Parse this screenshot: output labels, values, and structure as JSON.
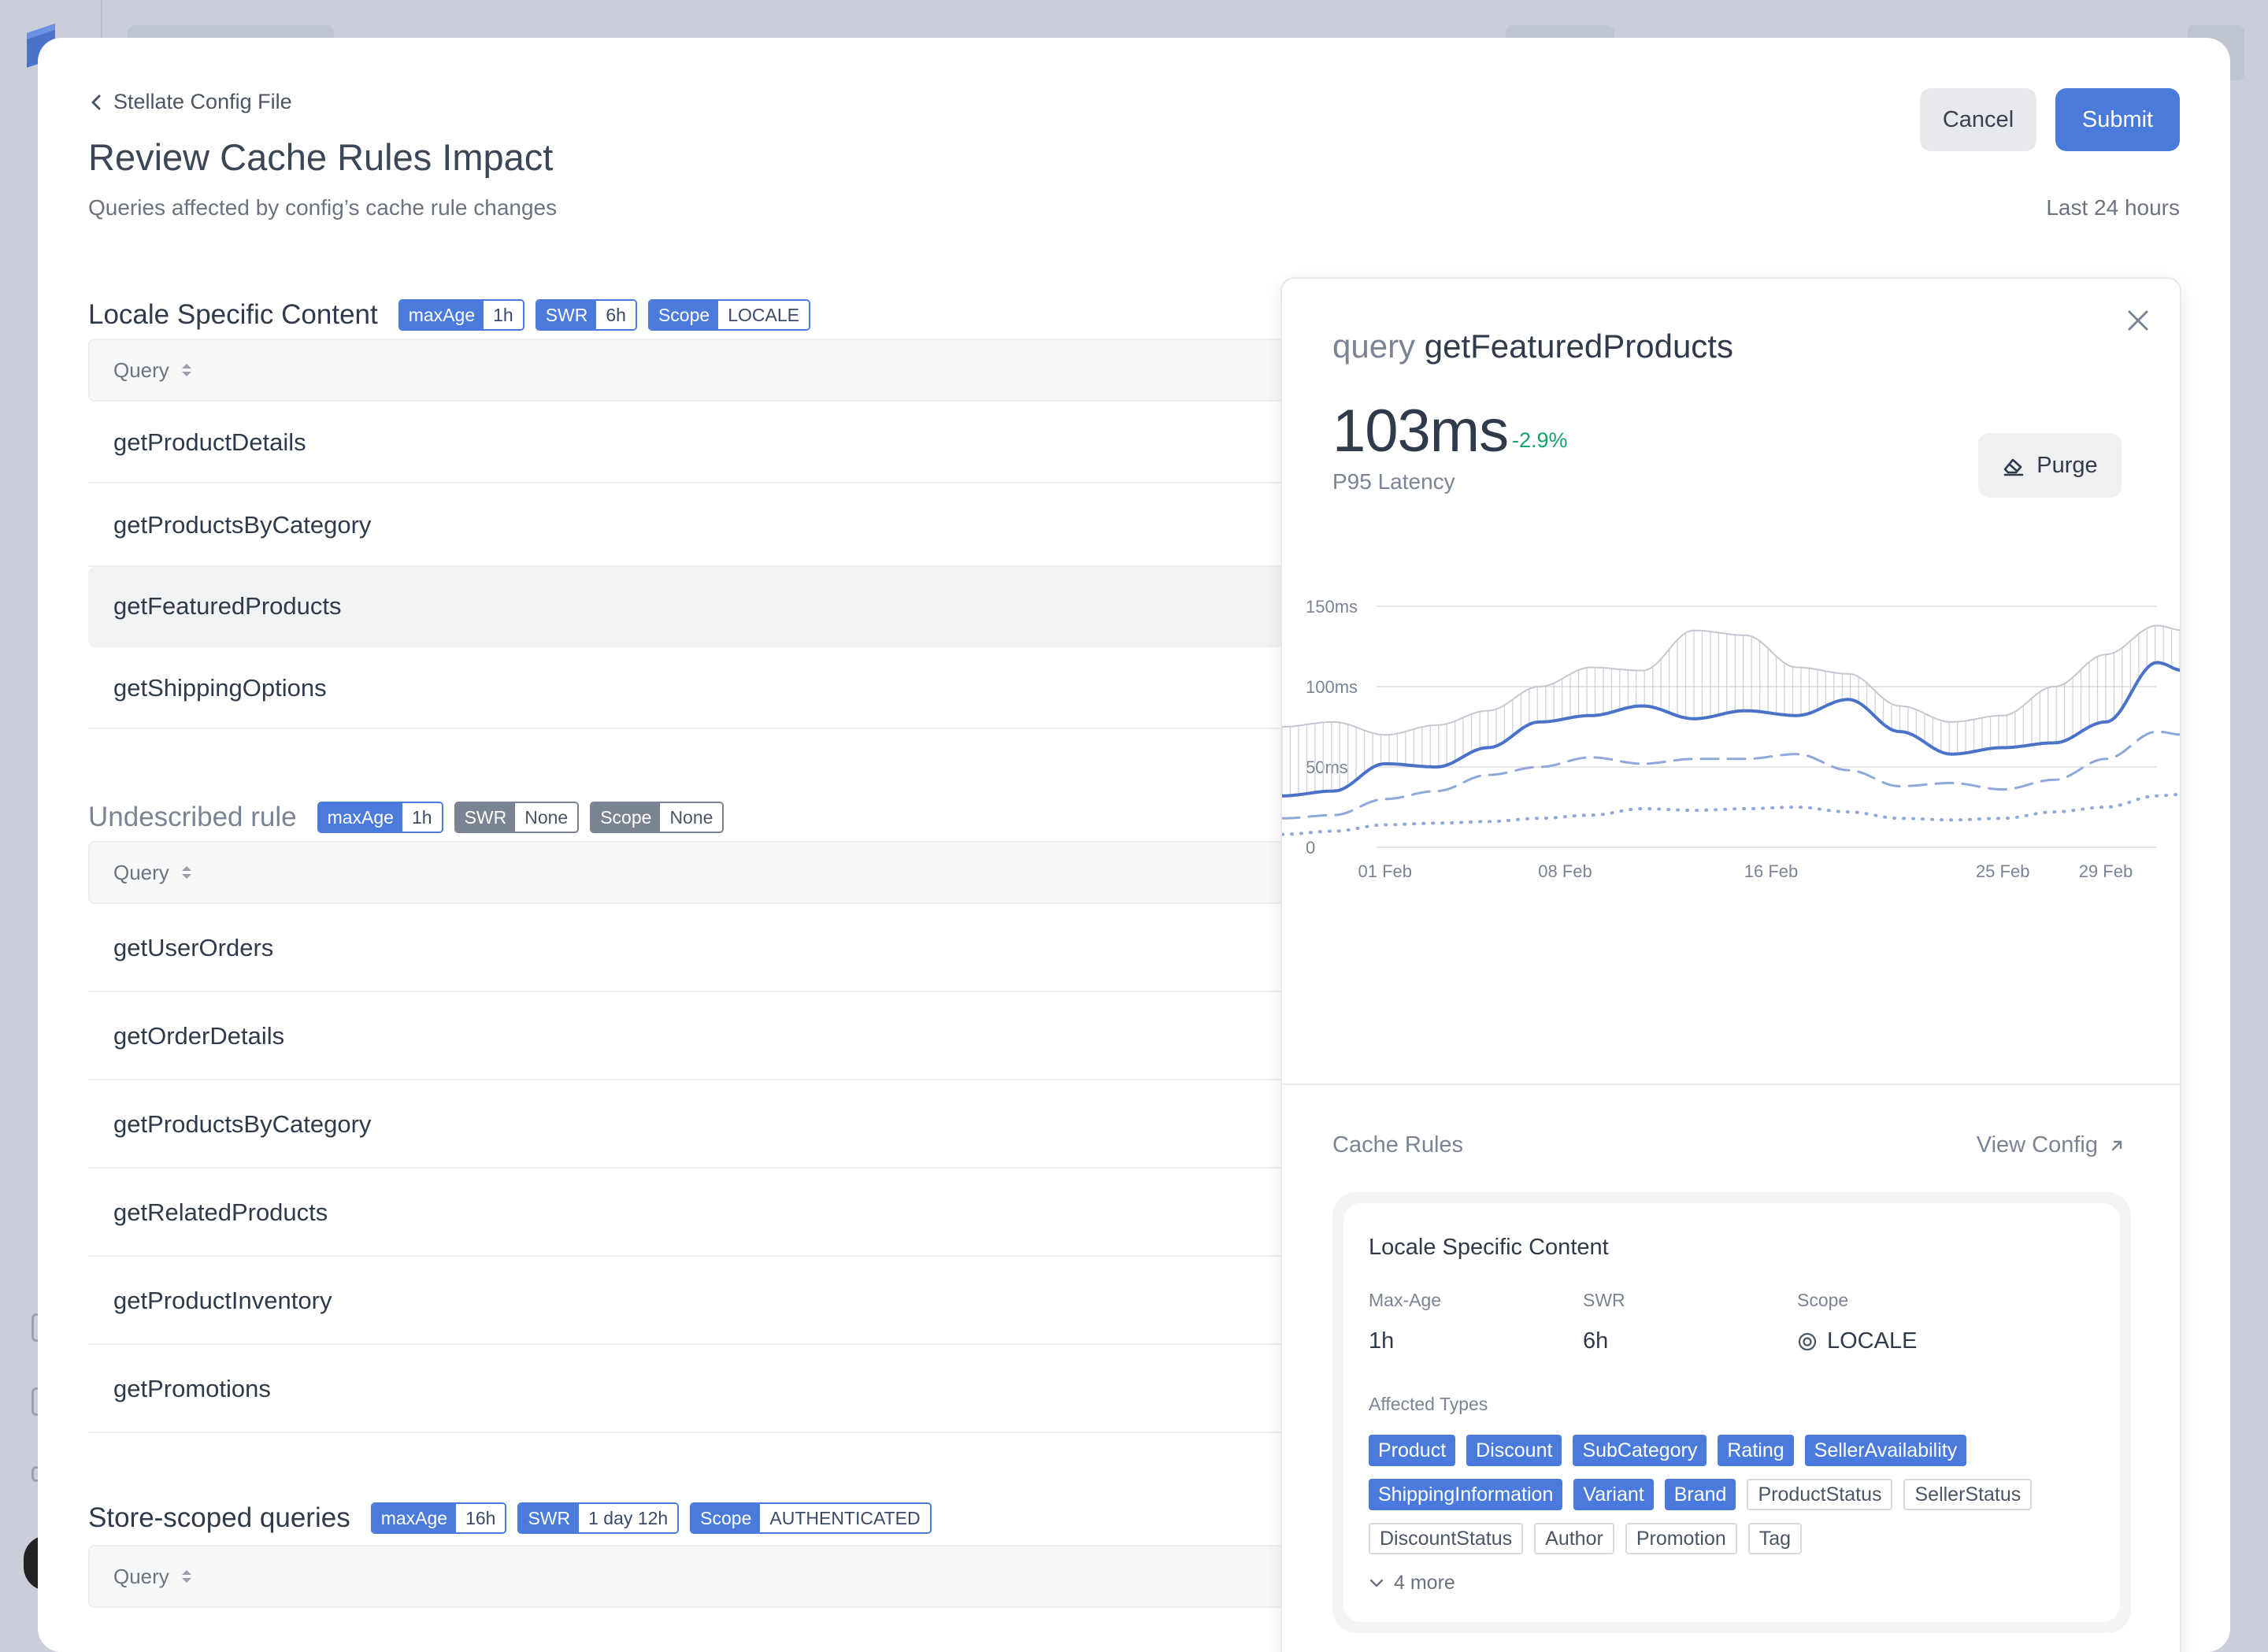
{
  "header": {
    "back_label": "Stellate Config File",
    "title": "Review Cache Rules Impact",
    "subtitle": "Queries affected by config’s cache rule changes",
    "cancel_label": "Cancel",
    "submit_label": "Submit",
    "time_range": "Last 24 hours"
  },
  "sections": [
    {
      "title": "Locale Specific Content",
      "tags": [
        {
          "key": "maxAge",
          "value": "1h"
        },
        {
          "key": "SWR",
          "value": "6h"
        },
        {
          "key": "Scope",
          "value": "LOCALE"
        }
      ],
      "column_header": "Query",
      "rows": [
        "getProductDetails",
        "getProductsByCategory",
        "getFeaturedProducts",
        "getShippingOptions"
      ]
    },
    {
      "title": "Undescribed rule",
      "tags": [
        {
          "key": "maxAge",
          "value": "1h"
        },
        {
          "key": "SWR",
          "value": "None"
        },
        {
          "key": "Scope",
          "value": "None"
        }
      ],
      "column_header": "Query",
      "rows": [
        "getUserOrders",
        "getOrderDetails",
        "getProductsByCategory",
        "getRelatedProducts",
        "getProductInventory",
        "getPromotions"
      ]
    },
    {
      "title": "Store-scoped queries",
      "tags": [
        {
          "key": "maxAge",
          "value": "16h"
        },
        {
          "key": "SWR",
          "value": "1 day 12h"
        },
        {
          "key": "Scope",
          "value": "AUTHENTICATED"
        }
      ],
      "column_header": "Query"
    }
  ],
  "panel": {
    "query_keyword": "query",
    "query_name": "getFeaturedProducts",
    "metric_value": "103ms",
    "metric_delta": "-2.9%",
    "metric_label": "P95 Latency",
    "purge_label": "Purge",
    "cache_rules_label": "Cache Rules",
    "view_config_label": "View Config",
    "rule_card": {
      "title": "Locale Specific Content",
      "max_age_label": "Max-Age",
      "max_age_value": "1h",
      "swr_label": "SWR",
      "swr_value": "6h",
      "scope_label": "Scope",
      "scope_value": "LOCALE",
      "affected_label": "Affected Types",
      "types_active": [
        "Product",
        "Discount",
        "SubCategory",
        "Rating",
        "SellerAvailability",
        "ShippingInformation",
        "Variant",
        "Brand"
      ],
      "types_inactive": [
        "ProductStatus",
        "SellerStatus",
        "DiscountStatus",
        "Author",
        "Promotion",
        "Tag"
      ],
      "more_label": "4 more"
    }
  },
  "chart_data": {
    "type": "line",
    "x_ticks": [
      "01 Feb",
      "08 Feb",
      "16 Feb",
      "25 Feb",
      "29 Feb"
    ],
    "y_ticks": [
      "0",
      "50ms",
      "100ms",
      "150ms"
    ],
    "ylim": [
      0,
      150
    ],
    "grid": true,
    "x_start_day": -3,
    "x_end_day": 32,
    "series": [
      {
        "style": "band-upper",
        "x": [
          -3,
          -1,
          1,
          3,
          5,
          7,
          9,
          11,
          13,
          15,
          17,
          19,
          21,
          23,
          25,
          27,
          29,
          31,
          32
        ],
        "values": [
          75,
          78,
          70,
          76,
          85,
          100,
          112,
          110,
          135,
          132,
          112,
          108,
          88,
          78,
          82,
          100,
          120,
          138,
          135
        ]
      },
      {
        "style": "solid",
        "x": [
          -3,
          -1,
          1,
          3,
          5,
          7,
          9,
          11,
          13,
          15,
          17,
          19,
          21,
          23,
          25,
          27,
          29,
          31,
          32
        ],
        "values": [
          32,
          35,
          52,
          50,
          62,
          78,
          82,
          88,
          80,
          85,
          82,
          92,
          72,
          58,
          62,
          65,
          78,
          115,
          110
        ]
      },
      {
        "style": "dashed",
        "x": [
          -3,
          -1,
          1,
          3,
          5,
          7,
          9,
          11,
          13,
          15,
          17,
          19,
          21,
          23,
          25,
          27,
          29,
          31,
          32
        ],
        "values": [
          18,
          20,
          30,
          35,
          45,
          50,
          56,
          52,
          55,
          55,
          58,
          48,
          38,
          40,
          36,
          42,
          55,
          72,
          70
        ]
      },
      {
        "style": "dotted",
        "x": [
          -3,
          -1,
          1,
          3,
          5,
          7,
          9,
          11,
          13,
          15,
          17,
          19,
          21,
          23,
          25,
          27,
          29,
          31,
          32
        ],
        "values": [
          8,
          10,
          14,
          15,
          16,
          18,
          20,
          24,
          23,
          24,
          25,
          22,
          18,
          17,
          18,
          22,
          25,
          32,
          33
        ]
      }
    ]
  },
  "colors": {
    "accent": "#4a7bdc",
    "positive": "#16a36a",
    "muted_tag": "#7a8391"
  }
}
